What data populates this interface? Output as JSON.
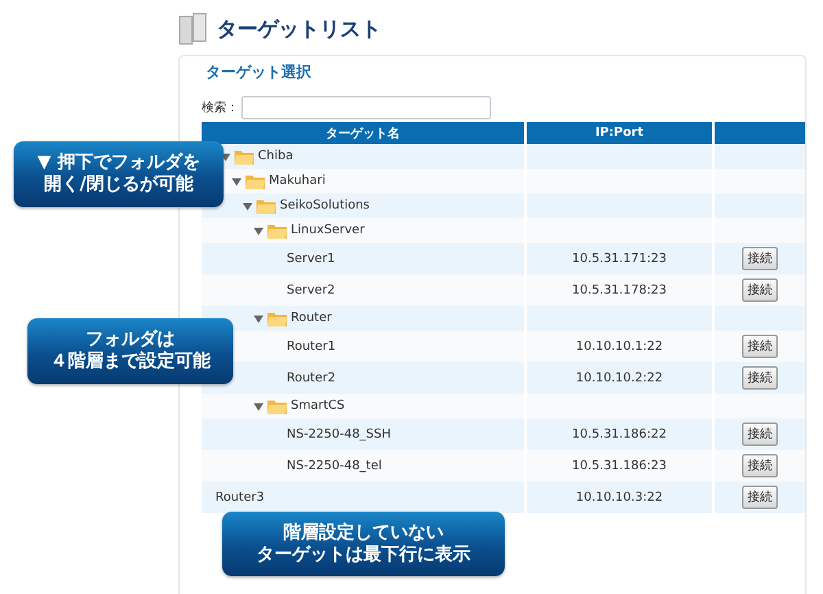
{
  "page_title": "ターゲットリスト",
  "panel": {
    "legend": "ターゲット選択",
    "search": {
      "label": "検索："
    },
    "table": {
      "columns": [
        "ターゲット名",
        "IP:Port"
      ],
      "rows": [
        {
          "kind": "folder",
          "name": "Chiba",
          "expanded": true,
          "children": [
            {
              "kind": "folder",
              "name": "Makuhari",
              "expanded": true,
              "children": [
                {
                  "kind": "folder",
                  "name": "SeikoSolutions",
                  "expanded": true,
                  "children": [
                    {
                      "kind": "folder",
                      "name": "LinuxServer",
                      "expanded": true,
                      "children": [
                        {
                          "kind": "target",
                          "name": "Server1",
                          "address": "10.5.31.171:23",
                          "action": "接続"
                        },
                        {
                          "kind": "target",
                          "name": "Server2",
                          "address": "10.5.31.178:23",
                          "action": "接続"
                        }
                      ]
                    },
                    {
                      "kind": "folder",
                      "name": "Router",
                      "expanded": true,
                      "children": [
                        {
                          "kind": "target",
                          "name": "Router1",
                          "address": "10.10.10.1:22",
                          "action": "接続"
                        },
                        {
                          "kind": "target",
                          "name": "Router2",
                          "address": "10.10.10.2:22",
                          "action": "接続"
                        }
                      ]
                    },
                    {
                      "kind": "folder",
                      "name": "SmartCS",
                      "expanded": true,
                      "children": [
                        {
                          "kind": "target",
                          "name": "NS-2250-48_SSH",
                          "address": "10.5.31.186:22",
                          "action": "接続"
                        },
                        {
                          "kind": "target",
                          "name": "NS-2250-48_tel",
                          "address": "10.5.31.186:23",
                          "action": "接続"
                        }
                      ]
                    }
                  ]
                }
              ]
            }
          ]
        },
        {
          "kind": "target",
          "name": "Router3",
          "address": "10.10.10.3:22",
          "action": "接続"
        }
      ]
    }
  },
  "callouts": [
    {
      "lines": [
        "▼ 押下でフォルダを",
        "開く/閉じるが可能"
      ]
    },
    {
      "lines": [
        "フォルダは",
        "４階層まで設定可能"
      ]
    },
    {
      "lines": [
        "階層設定していない",
        "ターゲットは最下行に表示"
      ]
    }
  ]
}
